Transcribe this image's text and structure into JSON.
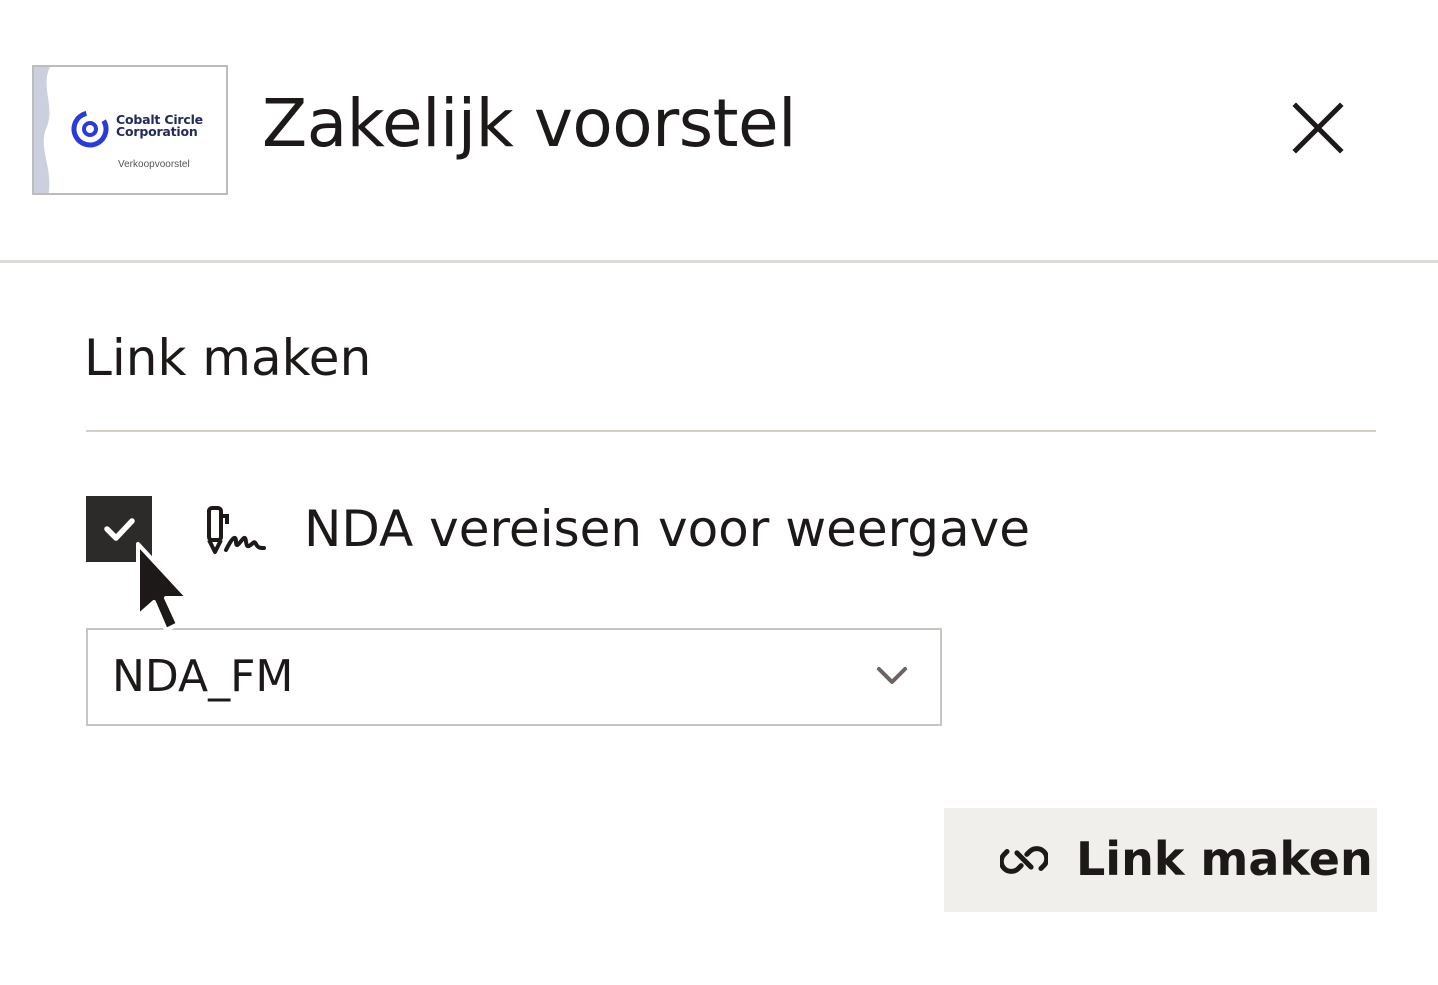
{
  "header": {
    "thumbnail": {
      "company_name": "Cobalt Circle Corporation",
      "document_label": "Verkoopvoorstel"
    },
    "title": "Zakelijk voorstel",
    "close_icon": "close-icon"
  },
  "section": {
    "title": "Link maken"
  },
  "nda_option": {
    "checked": true,
    "icon": "signature-icon",
    "label": "NDA vereisen voor weergave"
  },
  "nda_select": {
    "selected": "NDA_FM",
    "icon": "chevron-down-icon"
  },
  "create_button": {
    "icon": "link-icon",
    "label": "Link maken"
  },
  "colors": {
    "checkbox_fill": "#2d2b2a",
    "button_background": "#f1efec",
    "text": "#1e1919",
    "logo_blue": "#2b3bd6"
  }
}
